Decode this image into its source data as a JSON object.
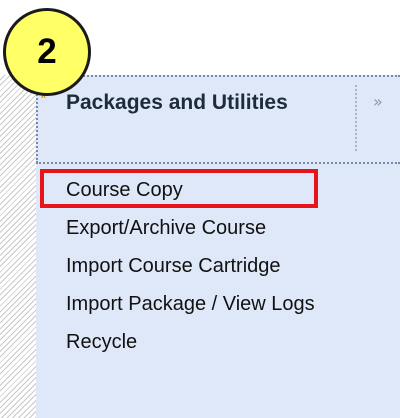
{
  "step_badge": {
    "number": "2"
  },
  "section": {
    "title": "Packages and Utilities",
    "expand_icon": "double-chevron-up-icon",
    "collapse_icon": "double-chevron-right-icon"
  },
  "menu": {
    "items": [
      {
        "label": "Course Copy",
        "highlighted": true
      },
      {
        "label": "Export/Archive Course",
        "highlighted": false
      },
      {
        "label": "Import Course Cartridge",
        "highlighted": false
      },
      {
        "label": "Import Package / View Logs",
        "highlighted": false
      },
      {
        "label": "Recycle",
        "highlighted": false
      }
    ]
  },
  "colors": {
    "panel_background": "#dfe8f8",
    "highlight_border": "#e8141b",
    "badge_fill": "#ffff66",
    "expand_icon": "#c89a16"
  }
}
